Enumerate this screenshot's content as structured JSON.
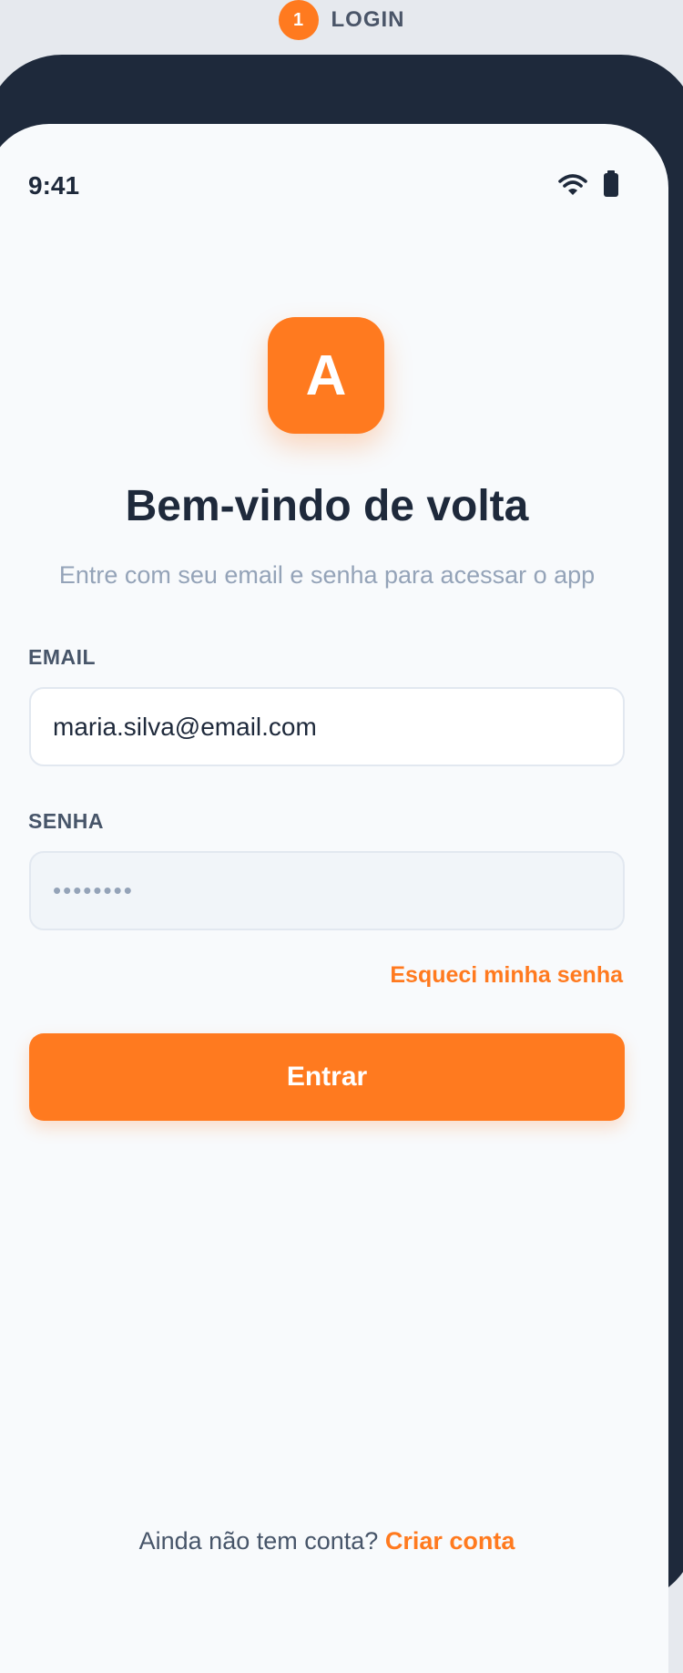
{
  "step": {
    "number": "1",
    "label": "LOGIN"
  },
  "status_bar": {
    "time": "9:41",
    "icons": [
      "wifi-icon",
      "battery-icon"
    ]
  },
  "app": {
    "logo_letter": "A"
  },
  "header": {
    "title": "Bem-vindo de volta",
    "subtitle": "Entre com seu email e senha para acessar o app"
  },
  "form": {
    "email_label": "EMAIL",
    "email_value": "maria.silva@email.com",
    "password_label": "SENHA",
    "password_mask": "••••••••",
    "forgot_password": "Esqueci minha senha",
    "submit_label": "Entrar"
  },
  "footer": {
    "prompt": "Ainda não tem conta?",
    "signup_link": "Criar conta"
  },
  "colors": {
    "accent": "#ff7a1f",
    "text_primary": "#1e293b",
    "text_muted": "#94a3b8",
    "background": "#f8fafc",
    "device_frame": "#1e293b"
  }
}
